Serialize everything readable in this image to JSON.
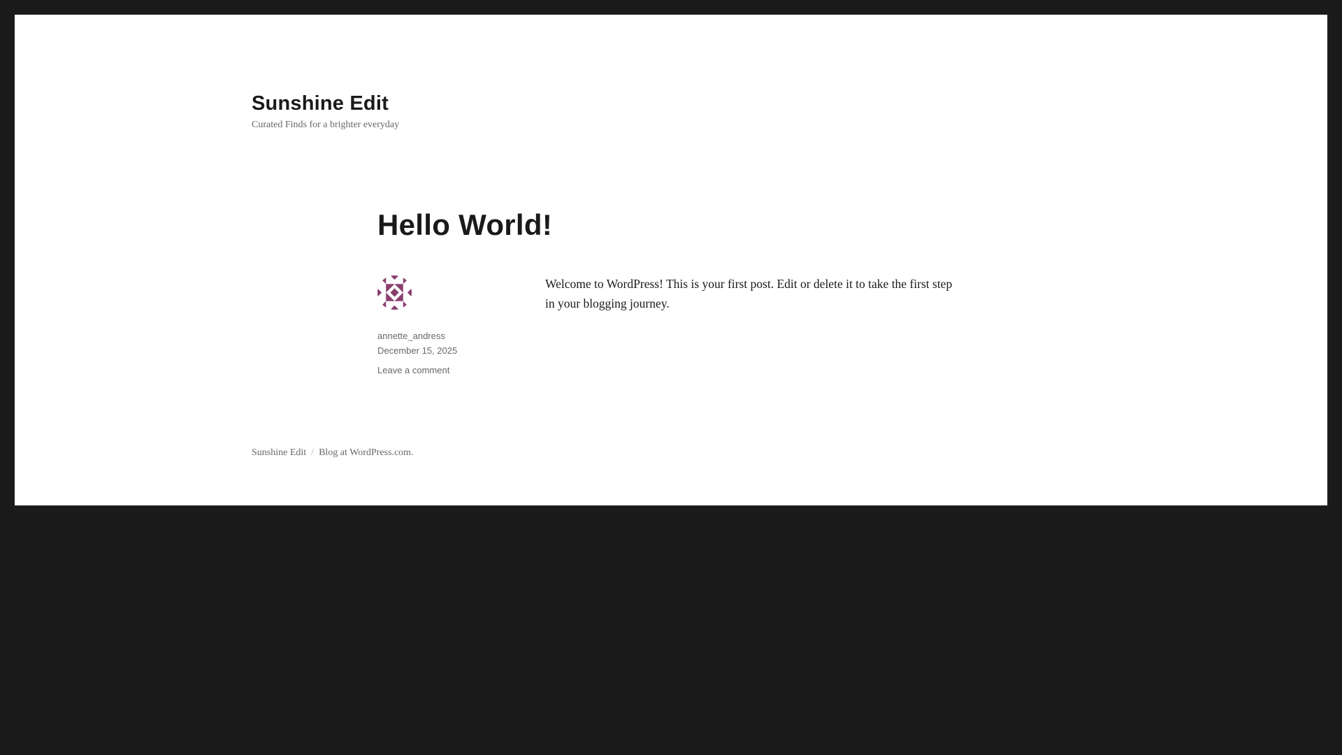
{
  "site": {
    "title": "Sunshine Edit",
    "tagline": "Curated Finds for a brighter everyday"
  },
  "post": {
    "title": "Hello World!",
    "author": "annette_andress",
    "date": "December 15, 2025",
    "comment_link": "Leave a comment",
    "content": "Welcome to WordPress! This is your first post. Edit or delete it to take the first step in your blogging journey."
  },
  "footer": {
    "site_link": "Sunshine Edit",
    "separator": "/",
    "credit": "Blog at WordPress.com."
  },
  "colors": {
    "avatar": "#8a3e6e",
    "frame": "#1a1a1a"
  }
}
